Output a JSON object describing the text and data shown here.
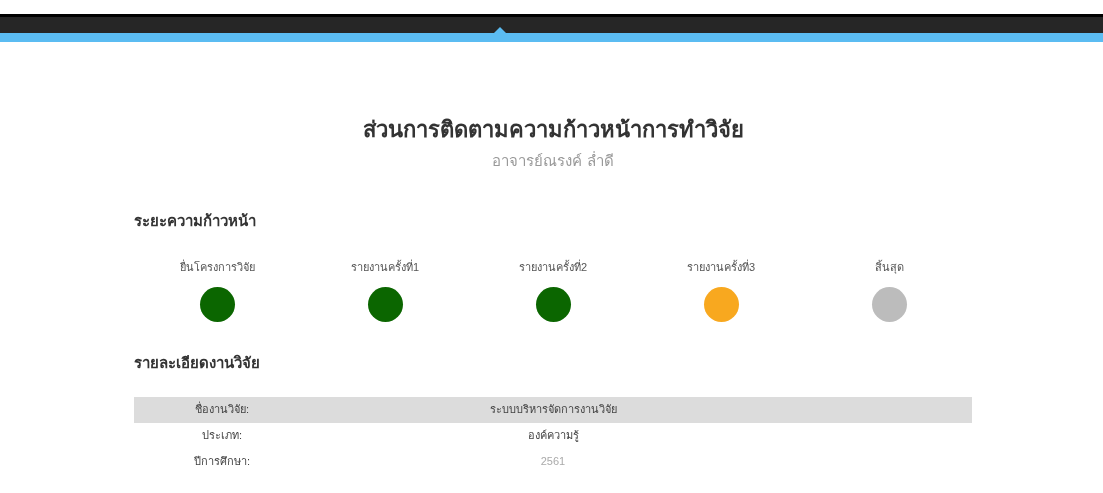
{
  "page": {
    "title": "ส่วนการติดตามความก้าวหน้าการทำวิจัย",
    "subtitle": "อาจารย์ณรงค์ ล่ำดี"
  },
  "progress": {
    "heading": "ระยะความก้าวหน้า",
    "steps": [
      {
        "label": "ยื่นโครงการวิจัย",
        "color": "#0b6600"
      },
      {
        "label": "รายงานครั้งที่1",
        "color": "#0b6600"
      },
      {
        "label": "รายงานครั้งที่2",
        "color": "#0b6600"
      },
      {
        "label": "รายงานครั้งที่3",
        "color": "#f8a81f"
      },
      {
        "label": "สิ้นสุด",
        "color": "#bcbcbc"
      }
    ]
  },
  "details": {
    "heading": "รายละเอียดงานวิจัย",
    "rows": [
      {
        "label": "ชื่องานวิจัย:",
        "value": "ระบบบริหารจัดการงานวิจัย",
        "shaded": true,
        "muted": false
      },
      {
        "label": "ประเภท:",
        "value": "องค์ความรู้",
        "shaded": false,
        "muted": false
      },
      {
        "label": "ปีการศึกษา:",
        "value": "2561",
        "shaded": false,
        "muted": true
      }
    ]
  }
}
